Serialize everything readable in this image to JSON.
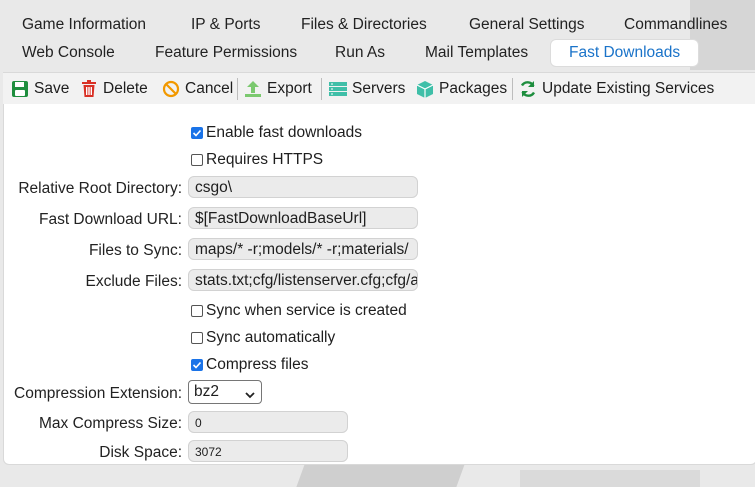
{
  "tabs_row1": [
    "Game Information",
    "IP & Ports",
    "Files & Directories",
    "General Settings",
    "Commandlines"
  ],
  "tabs_row2": [
    "Web Console",
    "Feature Permissions",
    "Run As",
    "Mail Templates",
    "Fast Downloads"
  ],
  "active_tab": "Fast Downloads",
  "toolbar": {
    "save": "Save",
    "delete": "Delete",
    "cancel": "Cancel",
    "export": "Export",
    "servers": "Servers",
    "packages": "Packages",
    "update": "Update Existing Services"
  },
  "form": {
    "enable_fast_downloads": {
      "label": "Enable fast downloads",
      "checked": true
    },
    "requires_https": {
      "label": "Requires HTTPS",
      "checked": false
    },
    "relative_root_label": "Relative Root Directory:",
    "relative_root_value": "csgo\\",
    "fast_url_label": "Fast Download URL:",
    "fast_url_value": "$[FastDownloadBaseUrl]",
    "files_sync_label": "Files to Sync:",
    "files_sync_value": "maps/* -r;models/* -r;materials/",
    "exclude_label": "Exclude Files:",
    "exclude_value": "stats.txt;cfg/listenserver.cfg;cfg/a",
    "sync_created": {
      "label": "Sync when service is created",
      "checked": false
    },
    "sync_auto": {
      "label": "Sync automatically",
      "checked": false
    },
    "compress": {
      "label": "Compress files",
      "checked": true
    },
    "compression_ext_label": "Compression Extension:",
    "compression_ext_value": "bz2",
    "max_compress_label": "Max Compress Size:",
    "max_compress_value": "0",
    "disk_space_label": "Disk Space:",
    "disk_space_value": "3072"
  },
  "colors": {
    "accent": "#1a73c9",
    "save_icon": "#1e8e3e",
    "delete_icon": "#d93025",
    "cancel_icon": "#f29900",
    "export_icon": "#7bc96f",
    "servers_icon": "#3fbfa8",
    "packages_icon": "#3fbfa8",
    "update_icon": "#1e8e3e"
  }
}
